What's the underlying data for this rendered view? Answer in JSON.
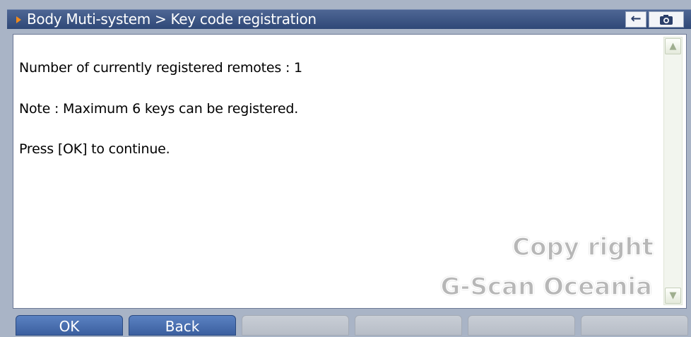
{
  "header": {
    "title": "Body Muti-system > Key code registration",
    "back_icon": "arrow-left-icon",
    "camera_icon": "camera-icon"
  },
  "content": {
    "lines": [
      "Number of currently registered remotes : 1",
      "Note : Maximum 6 keys can be registered.",
      "Press [OK] to continue."
    ]
  },
  "watermark": {
    "line1": "Copy right",
    "line2": "G-Scan Oceania"
  },
  "footer": {
    "buttons": [
      "OK",
      "Back",
      "",
      "",
      "",
      ""
    ]
  }
}
